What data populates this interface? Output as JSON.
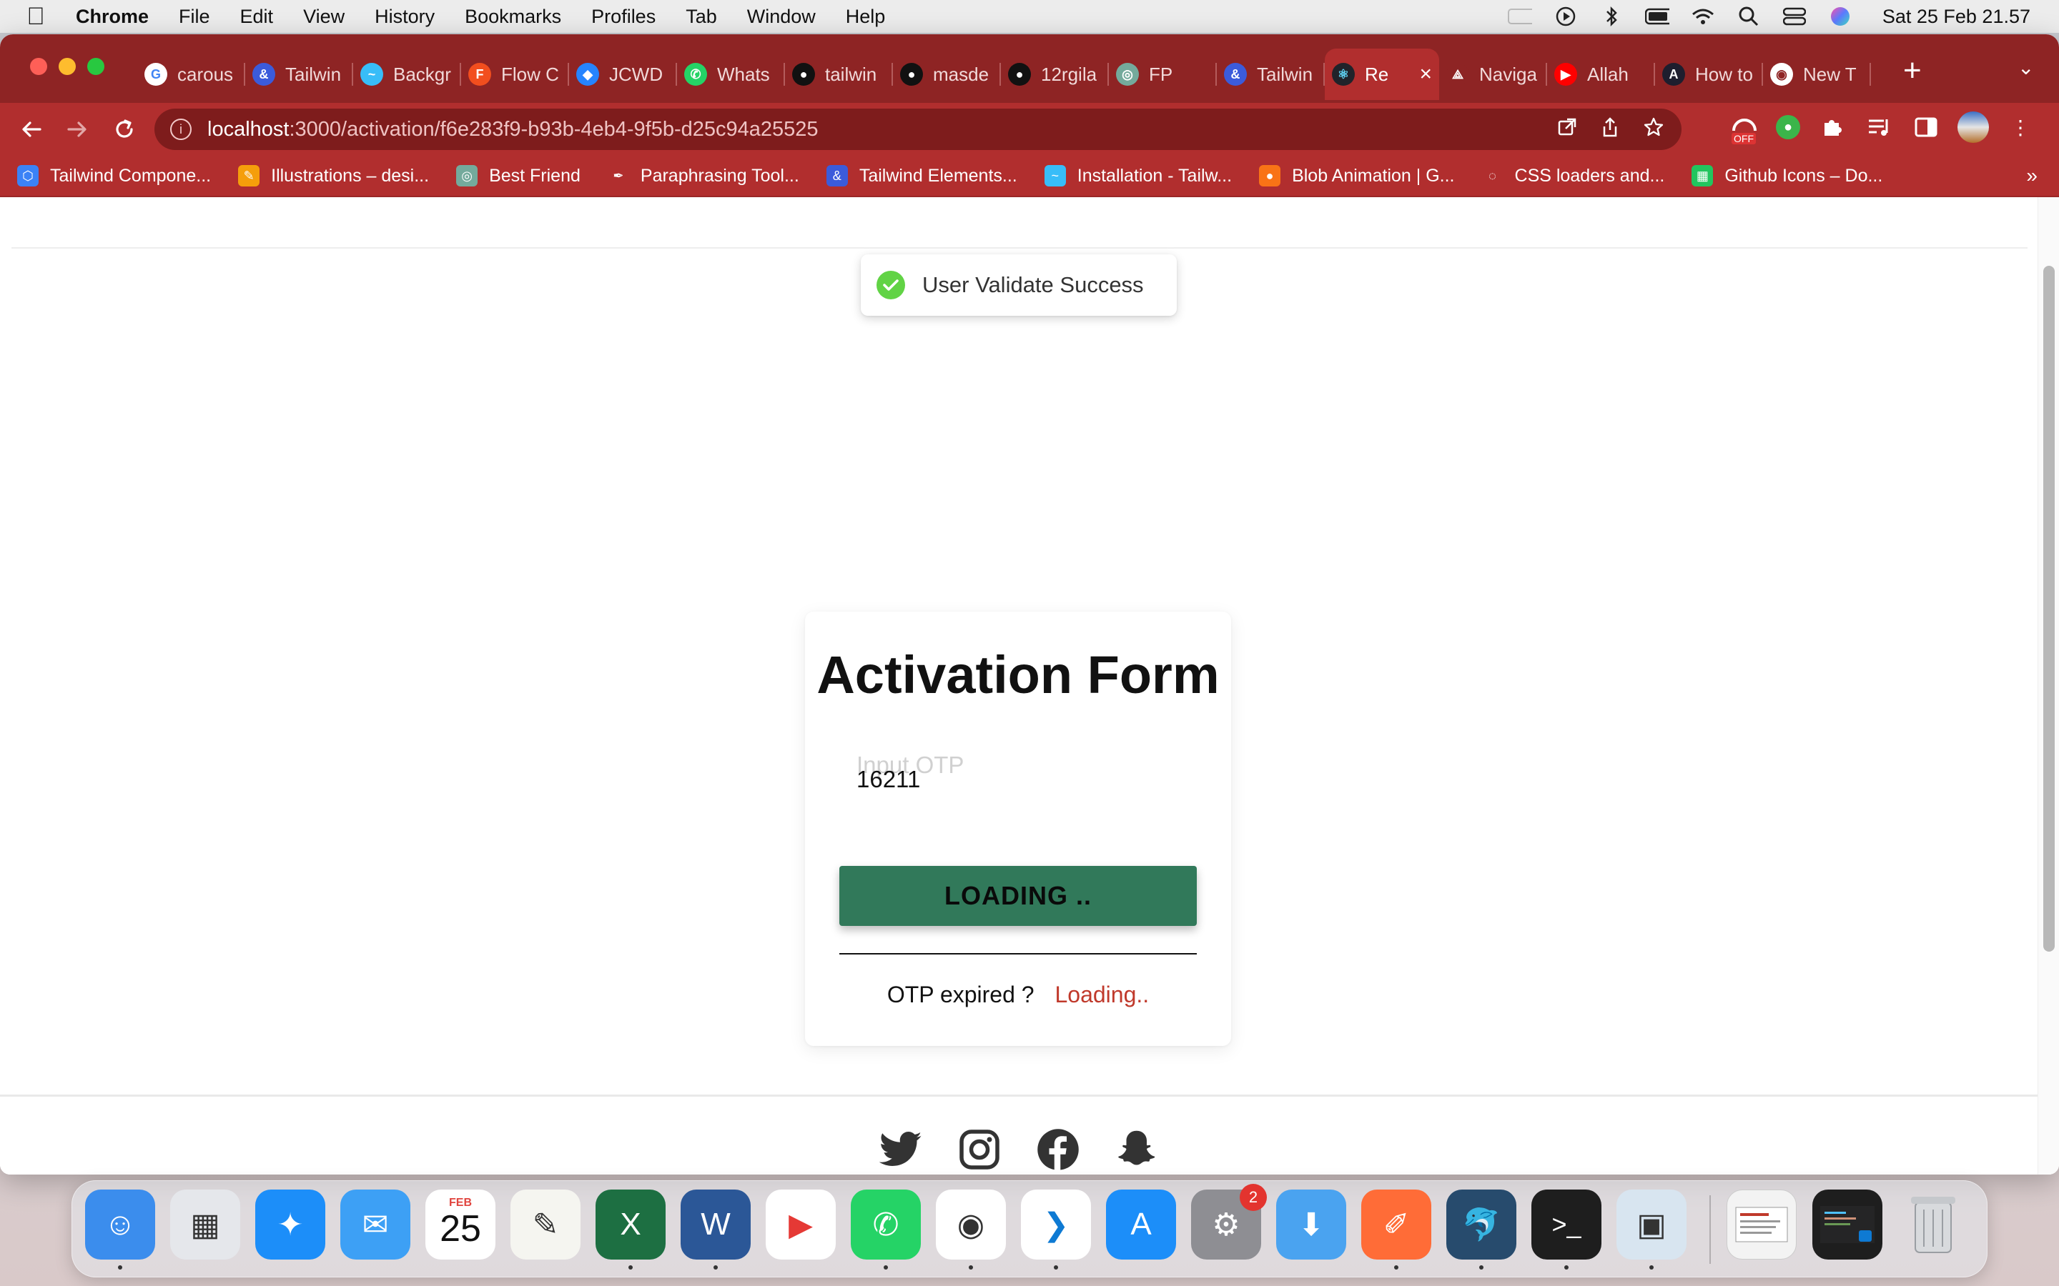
{
  "menubar": {
    "app_name": "Chrome",
    "items": [
      "File",
      "Edit",
      "View",
      "History",
      "Bookmarks",
      "Profiles",
      "Tab",
      "Window",
      "Help"
    ],
    "clock": "Sat 25 Feb  21.57"
  },
  "tabs": [
    {
      "label": "carous",
      "color": "#ffffff",
      "glyph": "G",
      "fg": "#4285f4"
    },
    {
      "label": "Tailwin",
      "color": "#3b5bdb",
      "glyph": "&",
      "fg": "#ffffff"
    },
    {
      "label": "Backgr",
      "color": "#38bdf8",
      "glyph": "~",
      "fg": "#ffffff"
    },
    {
      "label": "Flow C",
      "color": "#f24e1e",
      "glyph": "F",
      "fg": "#ffffff"
    },
    {
      "label": "JCWD",
      "color": "#2684ff",
      "glyph": "◆",
      "fg": "#ffffff"
    },
    {
      "label": "Whats",
      "color": "#25d366",
      "glyph": "✆",
      "fg": "#ffffff"
    },
    {
      "label": "tailwin",
      "color": "#111111",
      "glyph": "●",
      "fg": "#ffffff"
    },
    {
      "label": "masde",
      "color": "#111111",
      "glyph": "●",
      "fg": "#ffffff"
    },
    {
      "label": "12rgila",
      "color": "#111111",
      "glyph": "●",
      "fg": "#ffffff"
    },
    {
      "label": "FP",
      "color": "#74aa9c",
      "glyph": "◎",
      "fg": "#ffffff"
    },
    {
      "label": "Tailwin",
      "color": "#3b5bdb",
      "glyph": "&",
      "fg": "#ffffff"
    },
    {
      "label": "Re",
      "color": "#20232a",
      "glyph": "⚛",
      "fg": "#61dafb",
      "active": true
    },
    {
      "label": "Naviga",
      "color": "#8e2424",
      "glyph": "⟁",
      "fg": "#ffffff"
    },
    {
      "label": "Allah",
      "color": "#ff0000",
      "glyph": "▶",
      "fg": "#ffffff"
    },
    {
      "label": "How to",
      "color": "#1e1e2e",
      "glyph": "A",
      "fg": "#ffffff"
    },
    {
      "label": "New T",
      "color": "#ffffff",
      "glyph": "◉",
      "fg": "#8e2424"
    }
  ],
  "address": {
    "host": "localhost",
    "path": ":3000/activation/f6e283f9-b93b-4eb4-9f5b-d25c94a25525"
  },
  "bookmarks": [
    {
      "label": "Tailwind Compone...",
      "color": "#3b82f6",
      "glyph": "⬡"
    },
    {
      "label": "Illustrations – desi...",
      "color": "#f59e0b",
      "glyph": "✎"
    },
    {
      "label": "Best Friend",
      "color": "#74aa9c",
      "glyph": "◎"
    },
    {
      "label": "Paraphrasing Tool...",
      "color": "#b12e2e",
      "glyph": "✒"
    },
    {
      "label": "Tailwind Elements...",
      "color": "#3b5bdb",
      "glyph": "&"
    },
    {
      "label": "Installation - Tailw...",
      "color": "#38bdf8",
      "glyph": "~"
    },
    {
      "label": "Blob Animation | G...",
      "color": "#f97316",
      "glyph": "●"
    },
    {
      "label": "CSS loaders and...",
      "color": "#ffffff",
      "glyph": "◌"
    },
    {
      "label": "Github Icons – Do...",
      "color": "#22c55e",
      "glyph": "▦"
    }
  ],
  "toast": {
    "message": "User Validate Success",
    "status_color": "#61d345"
  },
  "form": {
    "title": "Activation Form",
    "otp_placeholder": "Input OTP",
    "otp_value": "16211",
    "submit_label": "LOADING ..",
    "resend_question": "OTP expired ?",
    "resend_link": "Loading..",
    "button_color": "#31795a",
    "link_color": "#c0392b"
  },
  "footer": {
    "socials": [
      "twitter-icon",
      "instagram-icon",
      "facebook-icon",
      "snapchat-icon"
    ]
  },
  "dock": {
    "calendar_month": "FEB",
    "calendar_day": "25",
    "settings_badge": "2",
    "apps": [
      {
        "name": "finder",
        "color": "#3b8ded",
        "glyph": "☺"
      },
      {
        "name": "launchpad",
        "color": "#e5e7eb",
        "glyph": "▦"
      },
      {
        "name": "safari",
        "color": "#1c8ef9",
        "glyph": "✦"
      },
      {
        "name": "mail",
        "color": "#3da0f5",
        "glyph": "✉"
      },
      {
        "name": "calendar",
        "color": "#ffffff",
        "glyph": ""
      },
      {
        "name": "textedit",
        "color": "#f5f5f0",
        "glyph": "✎"
      },
      {
        "name": "excel",
        "color": "#1d6f42",
        "glyph": "X"
      },
      {
        "name": "word",
        "color": "#2b5797",
        "glyph": "W"
      },
      {
        "name": "player",
        "color": "#ffffff",
        "glyph": "▶"
      },
      {
        "name": "whatsapp",
        "color": "#25d366",
        "glyph": "✆"
      },
      {
        "name": "chrome",
        "color": "#ffffff",
        "glyph": "◉"
      },
      {
        "name": "vscode",
        "color": "#ffffff",
        "glyph": "❯"
      },
      {
        "name": "app-store",
        "color": "#1c8ef9",
        "glyph": "A"
      },
      {
        "name": "system-settings",
        "color": "#8e8e93",
        "glyph": "⚙"
      },
      {
        "name": "downloader",
        "color": "#4aa3f0",
        "glyph": "⬇"
      },
      {
        "name": "postman",
        "color": "#ff6c37",
        "glyph": "✐"
      },
      {
        "name": "mysql-workbench",
        "color": "#274b6d",
        "glyph": "🐬"
      },
      {
        "name": "terminal",
        "color": "#1e1e1e",
        "glyph": ">_"
      },
      {
        "name": "preview",
        "color": "#d8e5f0",
        "glyph": "▣"
      }
    ]
  }
}
